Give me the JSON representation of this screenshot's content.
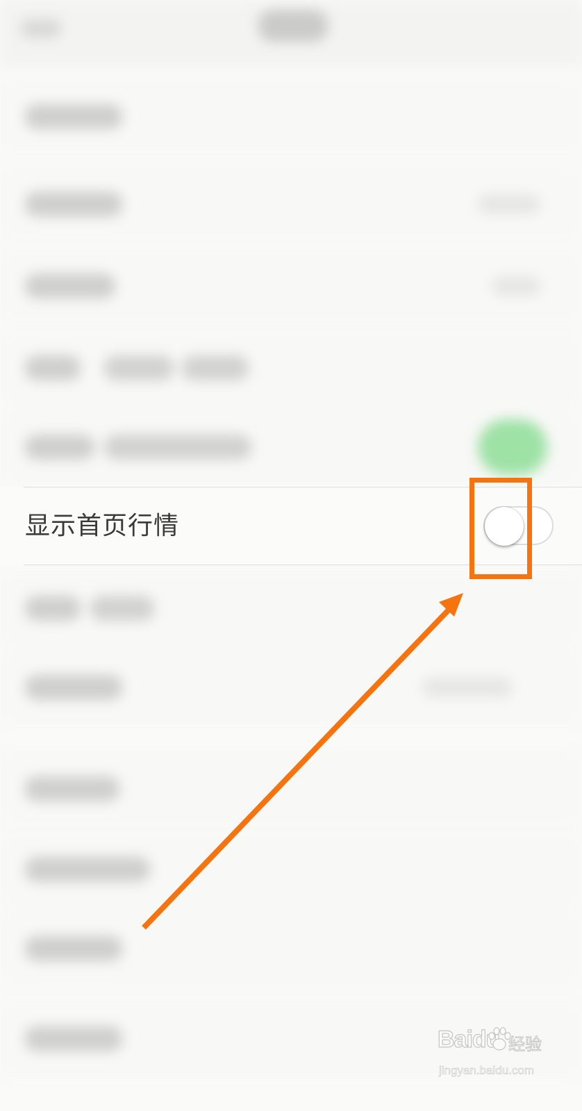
{
  "settings": {
    "highlighted_row": {
      "label": "显示首页行情",
      "toggle_on": false
    }
  },
  "annotation": {
    "color": "#f5740f",
    "shapes": [
      "highlight-box",
      "pointer-arrow"
    ]
  },
  "watermark": {
    "brand": "Baidu",
    "brand_cn": "经验",
    "url": "jingyan.baidu.com"
  },
  "colors": {
    "background": "#fafaf8",
    "toggle_off_border": "#dcdcdc",
    "blurred_toggle_on": "#9ee2a6"
  }
}
